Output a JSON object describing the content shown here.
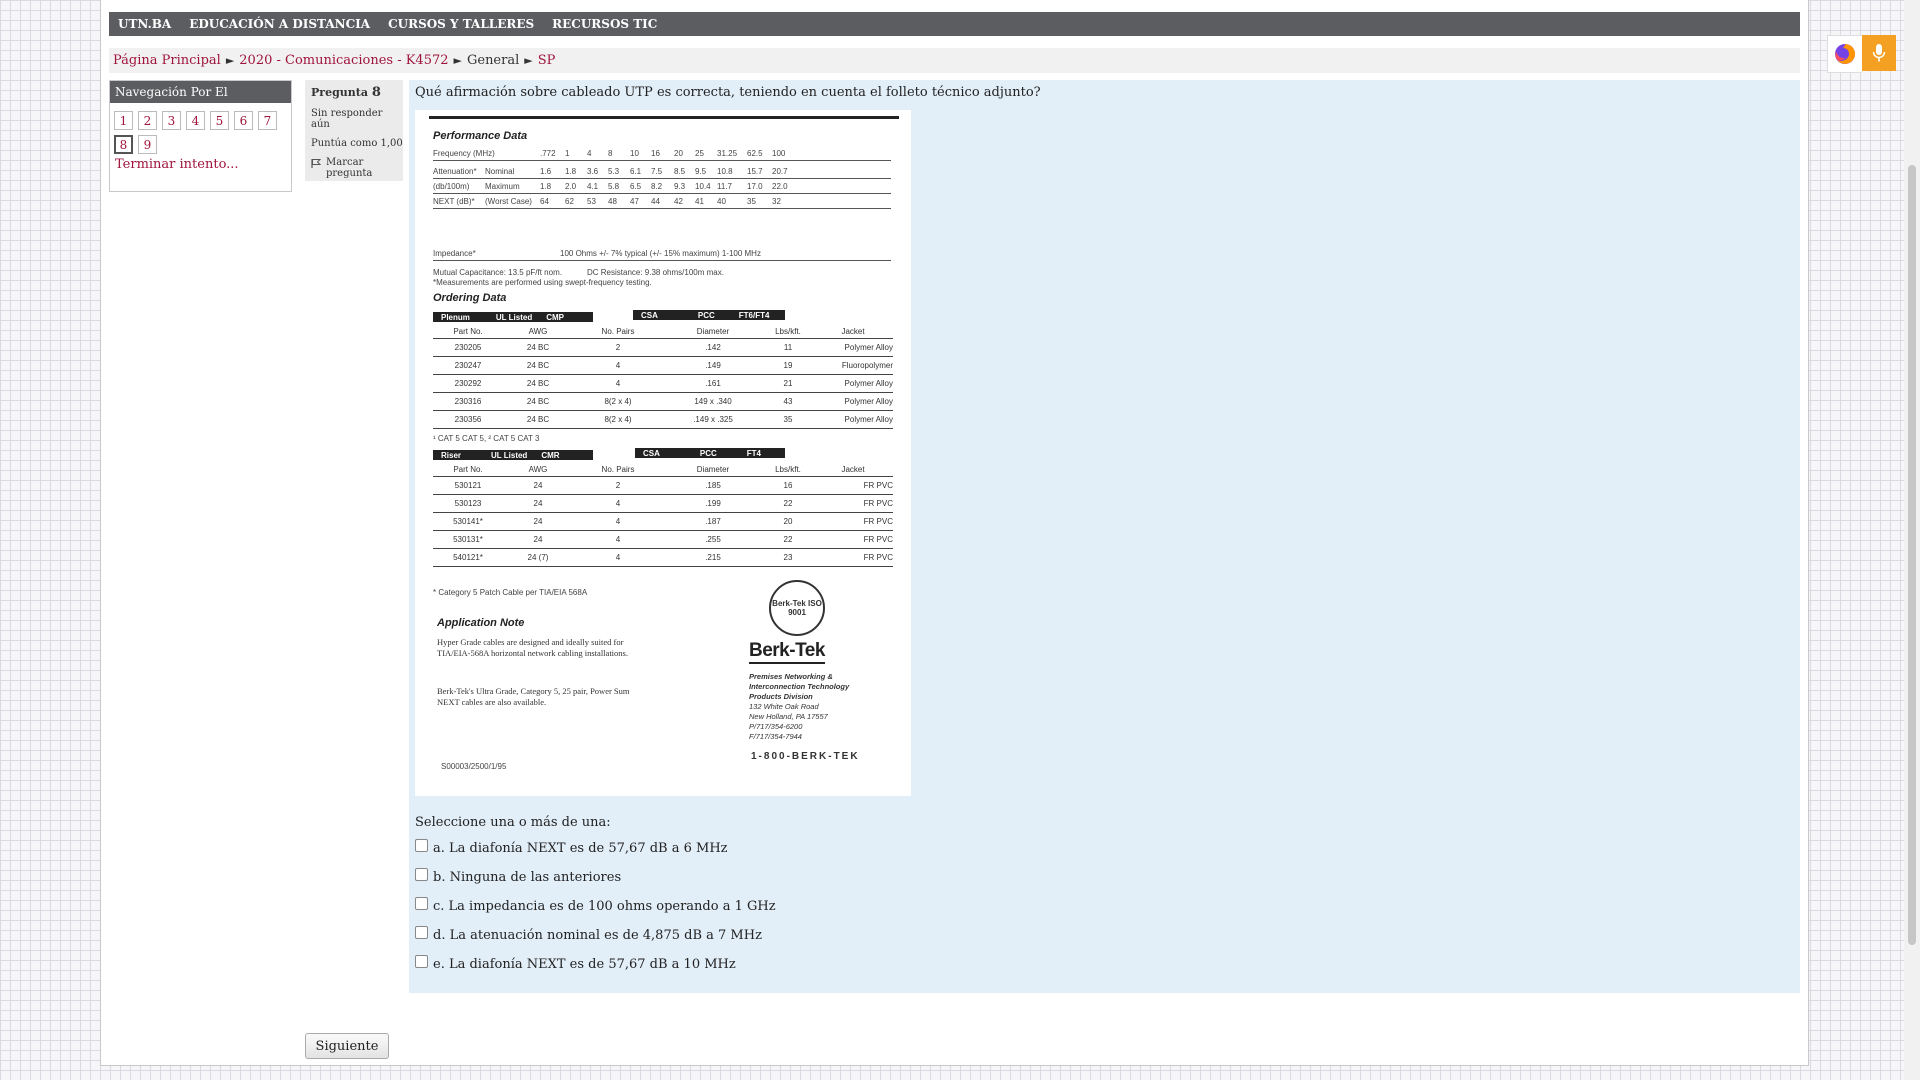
{
  "topnav": [
    "UTN.BA",
    "EDUCACIÓN A DISTANCIA",
    "CURSOS Y TALLERES",
    "RECURSOS TIC"
  ],
  "breadcrumb": {
    "home": "Página Principal",
    "course": "2020 - Comunicaciones - K4572",
    "section": "General",
    "current": "SP",
    "separator": "►"
  },
  "quiz_nav": {
    "title": "Navegación Por El Cuestionario",
    "buttons": [
      "1",
      "2",
      "3",
      "4",
      "5",
      "6",
      "7",
      "8",
      "9"
    ],
    "current": "8",
    "finish": "Terminar intento..."
  },
  "question_info": {
    "label": "Pregunta",
    "number": "8",
    "status": "Sin responder aún",
    "points": "Puntúa como 1,00",
    "flag": "Marcar pregunta"
  },
  "question": {
    "text": "Qué afirmación sobre cableado UTP es correcta, teniendo en cuenta el folleto técnico adjunto?",
    "prompt": "Seleccione una o más de una:",
    "options": [
      "a. La diafonía NEXT es de 57,67 dB a 6 MHz",
      "b. Ninguna de las anteriores",
      "c. La impedancia es de 100 ohms operando a 1 GHz",
      "d. La atenuación nominal es de 4,875 dB a 7 MHz",
      "e. La diafonía NEXT es de 57,67 dB a 10 MHz"
    ]
  },
  "datasheet": {
    "performance_title": "Performance Data",
    "freq_label": "Frequency (MHz)",
    "freq_values": [
      ".772",
      "1",
      "4",
      "8",
      "10",
      "16",
      "20",
      "25",
      "31.25",
      "62.5",
      "100"
    ],
    "atten_label": "Attenuation*",
    "atten_nominal": "Nominal",
    "atten_nominal_values": [
      "1.6",
      "1.8",
      "3.6",
      "5.3",
      "6.1",
      "7.5",
      "8.5",
      "9.5",
      "10.8",
      "15.7",
      "20.7"
    ],
    "atten_unit": "(db/100m)",
    "atten_max": "Maximum",
    "atten_max_values": [
      "1.8",
      "2.0",
      "4.1",
      "5.8",
      "6.5",
      "8.2",
      "9.3",
      "10.4",
      "11.7",
      "17.0",
      "22.0"
    ],
    "next_label": "NEXT (dB)*",
    "next_worst": "(Worst Case)",
    "next_values": [
      "64",
      "62",
      "53",
      "48",
      "47",
      "44",
      "42",
      "41",
      "40",
      "35",
      "32"
    ],
    "impedance_label": "Impedance*",
    "impedance_value": "100 Ohms +/- 7% typical (+/- 15% maximum) 1-100 MHz",
    "mutual_cap": "Mutual Capacitance: 13.5 pF/ft nom.",
    "dc_res": "DC Resistance: 9.38 ohms/100m max.",
    "measure_note": "*Measurements are performed using swept-frequency testing.",
    "ordering_title": "Ordering Data",
    "plenum_bar": [
      "Plenum",
      "UL Listed",
      "CMP"
    ],
    "csa_bar": [
      "CSA",
      "PCC",
      "FT6/FT4"
    ],
    "riser_bar": [
      "Riser",
      "UL Listed",
      "CMR"
    ],
    "csa_bar2": [
      "CSA",
      "PCC",
      "FT4"
    ],
    "headers": [
      "Part No.",
      "AWG",
      "No. Pairs",
      "Diameter",
      "Lbs/kft.",
      "Jacket"
    ],
    "plenum_rows": [
      [
        "230205",
        "24 BC",
        "2",
        ".142",
        "11",
        "Polymer Alloy"
      ],
      [
        "230247",
        "24 BC",
        "4",
        ".149",
        "19",
        "Fluoropolymer"
      ],
      [
        "230292",
        "24 BC",
        "4",
        ".161",
        "21",
        "Polymer Alloy"
      ],
      [
        "230316",
        "24 BC",
        "8(2 x 4)",
        "149 x .340",
        "43",
        "Polymer Alloy"
      ],
      [
        "230356",
        "24 BC",
        "8(2 x 4)",
        ".149 x .325",
        "35",
        "Polymer Alloy"
      ]
    ],
    "plenum_note": "¹ CAT 5   CAT 5,   ² CAT 5   CAT 3",
    "riser_rows": [
      [
        "530121",
        "24",
        "2",
        ".185",
        "16",
        "FR PVC"
      ],
      [
        "530123",
        "24",
        "4",
        ".199",
        "22",
        "FR PVC"
      ],
      [
        "530141*",
        "24",
        "4",
        ".187",
        "20",
        "FR PVC"
      ],
      [
        "530131*",
        "24",
        "4",
        ".255",
        "22",
        "FR PVC"
      ],
      [
        "540121*",
        "24 (7)",
        "4",
        ".215",
        "23",
        "FR PVC"
      ]
    ],
    "riser_note": "* Category 5 Patch Cable per TIA/EIA 568A",
    "app_title": "Application Note",
    "app_text_1": "Hyper Grade cables are designed and ideally suited for TIA/EIA-568A horizontal network cabling installations.",
    "app_text_2": "Berk-Tek's Ultra Grade, Category 5, 25 pair, Power Sum NEXT cables are also available.",
    "seal_text": "Berk-Tek ISO 9001",
    "brand": "Berk-Tek",
    "addr_lines": [
      "Premises Networking &",
      "Interconnection Technology",
      "Products Division",
      "132 White Oak Road",
      "New Holland, PA 17557",
      "P/717/354-6200",
      "F/717/354-7944"
    ],
    "phone": "1-800-BERK-TEK",
    "doc_code": "S00003/2500/1/95"
  },
  "next_button": "Siguiente",
  "colors": {
    "link": "#a0143c",
    "nav_bg": "#5c5d61",
    "content_bg": "#e2eef8"
  }
}
